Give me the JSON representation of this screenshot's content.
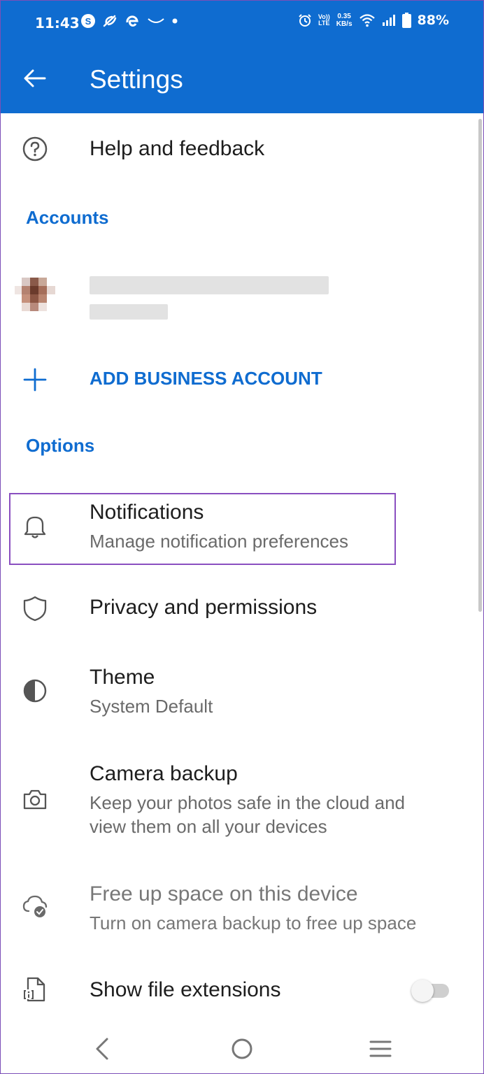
{
  "status_bar": {
    "time": "11:43",
    "network_speed_value": "0.35",
    "network_speed_unit": "KB/s",
    "volte": "Vo))",
    "lte": "LTE",
    "battery": "88%"
  },
  "app_bar": {
    "title": "Settings"
  },
  "help": {
    "label": "Help and feedback"
  },
  "accounts": {
    "header": "Accounts",
    "add_business_label": "ADD BUSINESS ACCOUNT"
  },
  "options": {
    "header": "Options",
    "notifications": {
      "label": "Notifications",
      "subtitle": "Manage notification preferences"
    },
    "privacy": {
      "label": "Privacy and permissions"
    },
    "theme": {
      "label": "Theme",
      "subtitle": "System Default"
    },
    "camera_backup": {
      "label": "Camera backup",
      "subtitle_line1": "Keep your photos safe in the cloud and",
      "subtitle_line2": "view them on all your devices"
    },
    "free_up_space": {
      "label": "Free up space on this device",
      "subtitle": "Turn on camera backup to free up space"
    },
    "file_extensions": {
      "label": "Show file extensions",
      "enabled": false
    }
  },
  "colors": {
    "accent": "#0f6cd0",
    "highlight_border": "#8a4fc0"
  }
}
